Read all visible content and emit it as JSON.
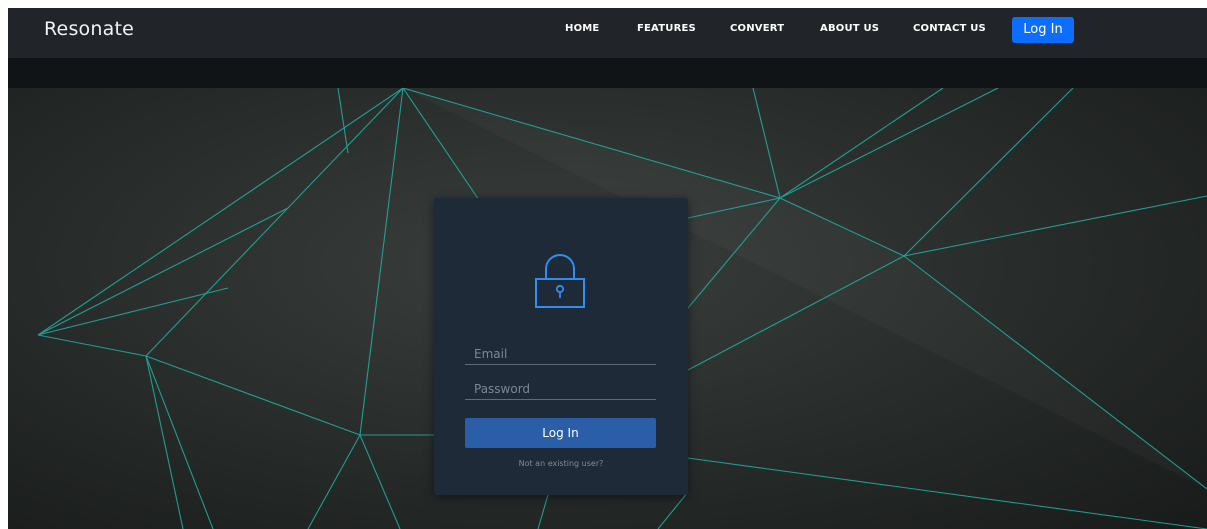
{
  "navbar": {
    "brand": "Resonate",
    "links": [
      "HOME",
      "FEATURES",
      "CONVERT",
      "ABOUT US",
      "CONTACT US"
    ],
    "login_label": "Log In"
  },
  "login_card": {
    "icon": "lock-icon",
    "email_placeholder": "Email",
    "password_placeholder": "Password",
    "submit_label": "Log In",
    "register_link": "Not an existing user?"
  },
  "colors": {
    "accent": "#0d6efd",
    "navbar_bg": "#212529",
    "card_bg": "#1f2a38",
    "button_bg": "#2b5ea8",
    "line_color": "#1fb3a6"
  }
}
